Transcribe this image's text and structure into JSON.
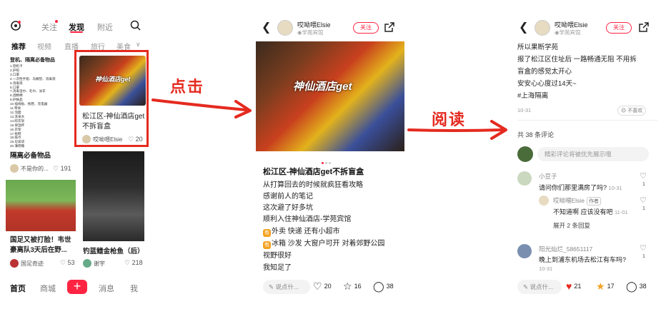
{
  "annotations": {
    "step1": "点击",
    "step2": "阅读"
  },
  "colors": {
    "accent": "#ff2442",
    "annotation_red": "#e52a1f",
    "tag_blue": "#2a5aa8"
  },
  "feed": {
    "nav": {
      "follow": "关注",
      "discover": "发现",
      "nearby": "附近"
    },
    "categories": [
      "推荐",
      "视频",
      "直播",
      "旅行",
      "美食"
    ],
    "cards": [
      {
        "title": "隔离必备物品",
        "author": "不是你的...",
        "likes": "191",
        "preview_heading": "登机、隔离必备物品",
        "preview_lines": [
          "1.登机卡",
          "2.护照",
          "3.口罩",
          "4.一次性手套、马桶垫、消毒液",
          "5.消毒液",
          "6.口罩",
          "7.消毒湿巾、毛巾、泳衣",
          "8.酒精棉",
          "9.护肤品",
          "10.插线板、拖鞋、充电器",
          "11.零食",
          "12.泡面",
          "13.洗发水",
          "14.晾衣架",
          "15.保温杯",
          "16.衣架",
          "17.拖鞋",
          "18.纸巾",
          "19.垃圾袋",
          "20.薄荷糖"
        ]
      },
      {
        "title": "松江区-神仙酒店get不拆盲盒",
        "author": "哎呦喂Elsie",
        "likes": "20",
        "image_text": "神仙酒店get"
      },
      {
        "title": "国足又被打脸！韦世豪离队3天后在野...",
        "author": "国足奇迹",
        "likes": "53"
      },
      {
        "title": "钓蓝鳍金枪鱼（后）",
        "author": "谢宇",
        "likes": "218"
      }
    ],
    "bottom_nav": {
      "home": "首页",
      "mall": "商城",
      "plus": "+",
      "messages": "消息",
      "me": "我"
    }
  },
  "note": {
    "author": "哎呦喂Elsie",
    "location": "学苑宾馆",
    "follow_label": "关注",
    "image_text": "神仙酒店get",
    "title": "松江区-神仙酒店get不拆盲盒",
    "lines": [
      "从打算回去的时候就疯狂看攻略",
      "感谢前人的笔记",
      "这次避了好多坑",
      "顺利入住神仙酒店-学苑宾馆",
      "外卖 快递 还有小超市",
      "冰箱 沙发 大窗户可开 对着郊野公园",
      "视野很好",
      "我知足了"
    ],
    "emoji1": "有",
    "emoji2": "有",
    "say_placeholder": "说点什...",
    "likes": "20",
    "collects": "16",
    "comments": "38"
  },
  "comments_view": {
    "author": "哎呦喂Elsie",
    "location": "学苑宾馆",
    "follow_label": "关注",
    "body_lines": [
      "所以果断学苑",
      "报了松江区住址后 一路畅通无阻 不用拆",
      "盲盒的感觉太开心",
      "安安心心度过14天~"
    ],
    "hashtag": "#上海隔离",
    "date": "10-31",
    "dislike": "不喜欢",
    "count_label": "共 38 条评论",
    "input_placeholder": "精彩评论将被优先展示哦",
    "comments": [
      {
        "name": "小豆子",
        "text": "请问你们那里满房了吗?",
        "date": "10-31",
        "likes": "1"
      },
      {
        "name": "哎呦喂Elsie",
        "badge": "作者",
        "text": "不知道啊 应该没有吧",
        "date": "11-01",
        "likes": "1"
      },
      {
        "name": "阳光灿烂_58651117",
        "text": "晚上到浦东机场去松江有车吗?",
        "date": "10-31",
        "likes": "1"
      }
    ],
    "expand_replies": "展开 2 条回复",
    "say_placeholder": "说点什...",
    "likes": "21",
    "collects": "17",
    "comment_count": "38"
  }
}
